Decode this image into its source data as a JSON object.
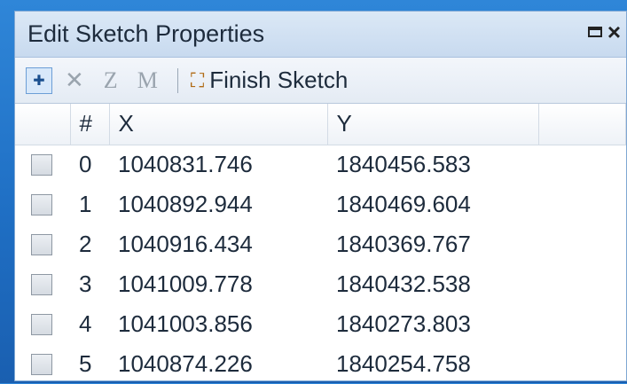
{
  "panel": {
    "title": "Edit Sketch Properties",
    "restore_icon": "restore-icon",
    "close_label": "×"
  },
  "toolbar": {
    "vertex_tool_icon": "vertex-tool-icon",
    "delete_label": "✕",
    "z_label": "Z",
    "m_label": "M",
    "finish_icon": "finish-sketch-icon",
    "finish_label": "Finish Sketch"
  },
  "table": {
    "headers": [
      "",
      "#",
      "X",
      "Y",
      ""
    ],
    "rows": [
      {
        "num": "0",
        "x": "1040831.746",
        "y": "1840456.583"
      },
      {
        "num": "1",
        "x": "1040892.944",
        "y": "1840469.604"
      },
      {
        "num": "2",
        "x": "1040916.434",
        "y": "1840369.767"
      },
      {
        "num": "3",
        "x": "1041009.778",
        "y": "1840432.538"
      },
      {
        "num": "4",
        "x": "1041003.856",
        "y": "1840273.803"
      },
      {
        "num": "5",
        "x": "1040874.226",
        "y": "1840254.758"
      }
    ]
  },
  "colors": {
    "background": "#2f86d8",
    "titlebar": "#dbe8f6",
    "text": "#1d2b3c"
  }
}
